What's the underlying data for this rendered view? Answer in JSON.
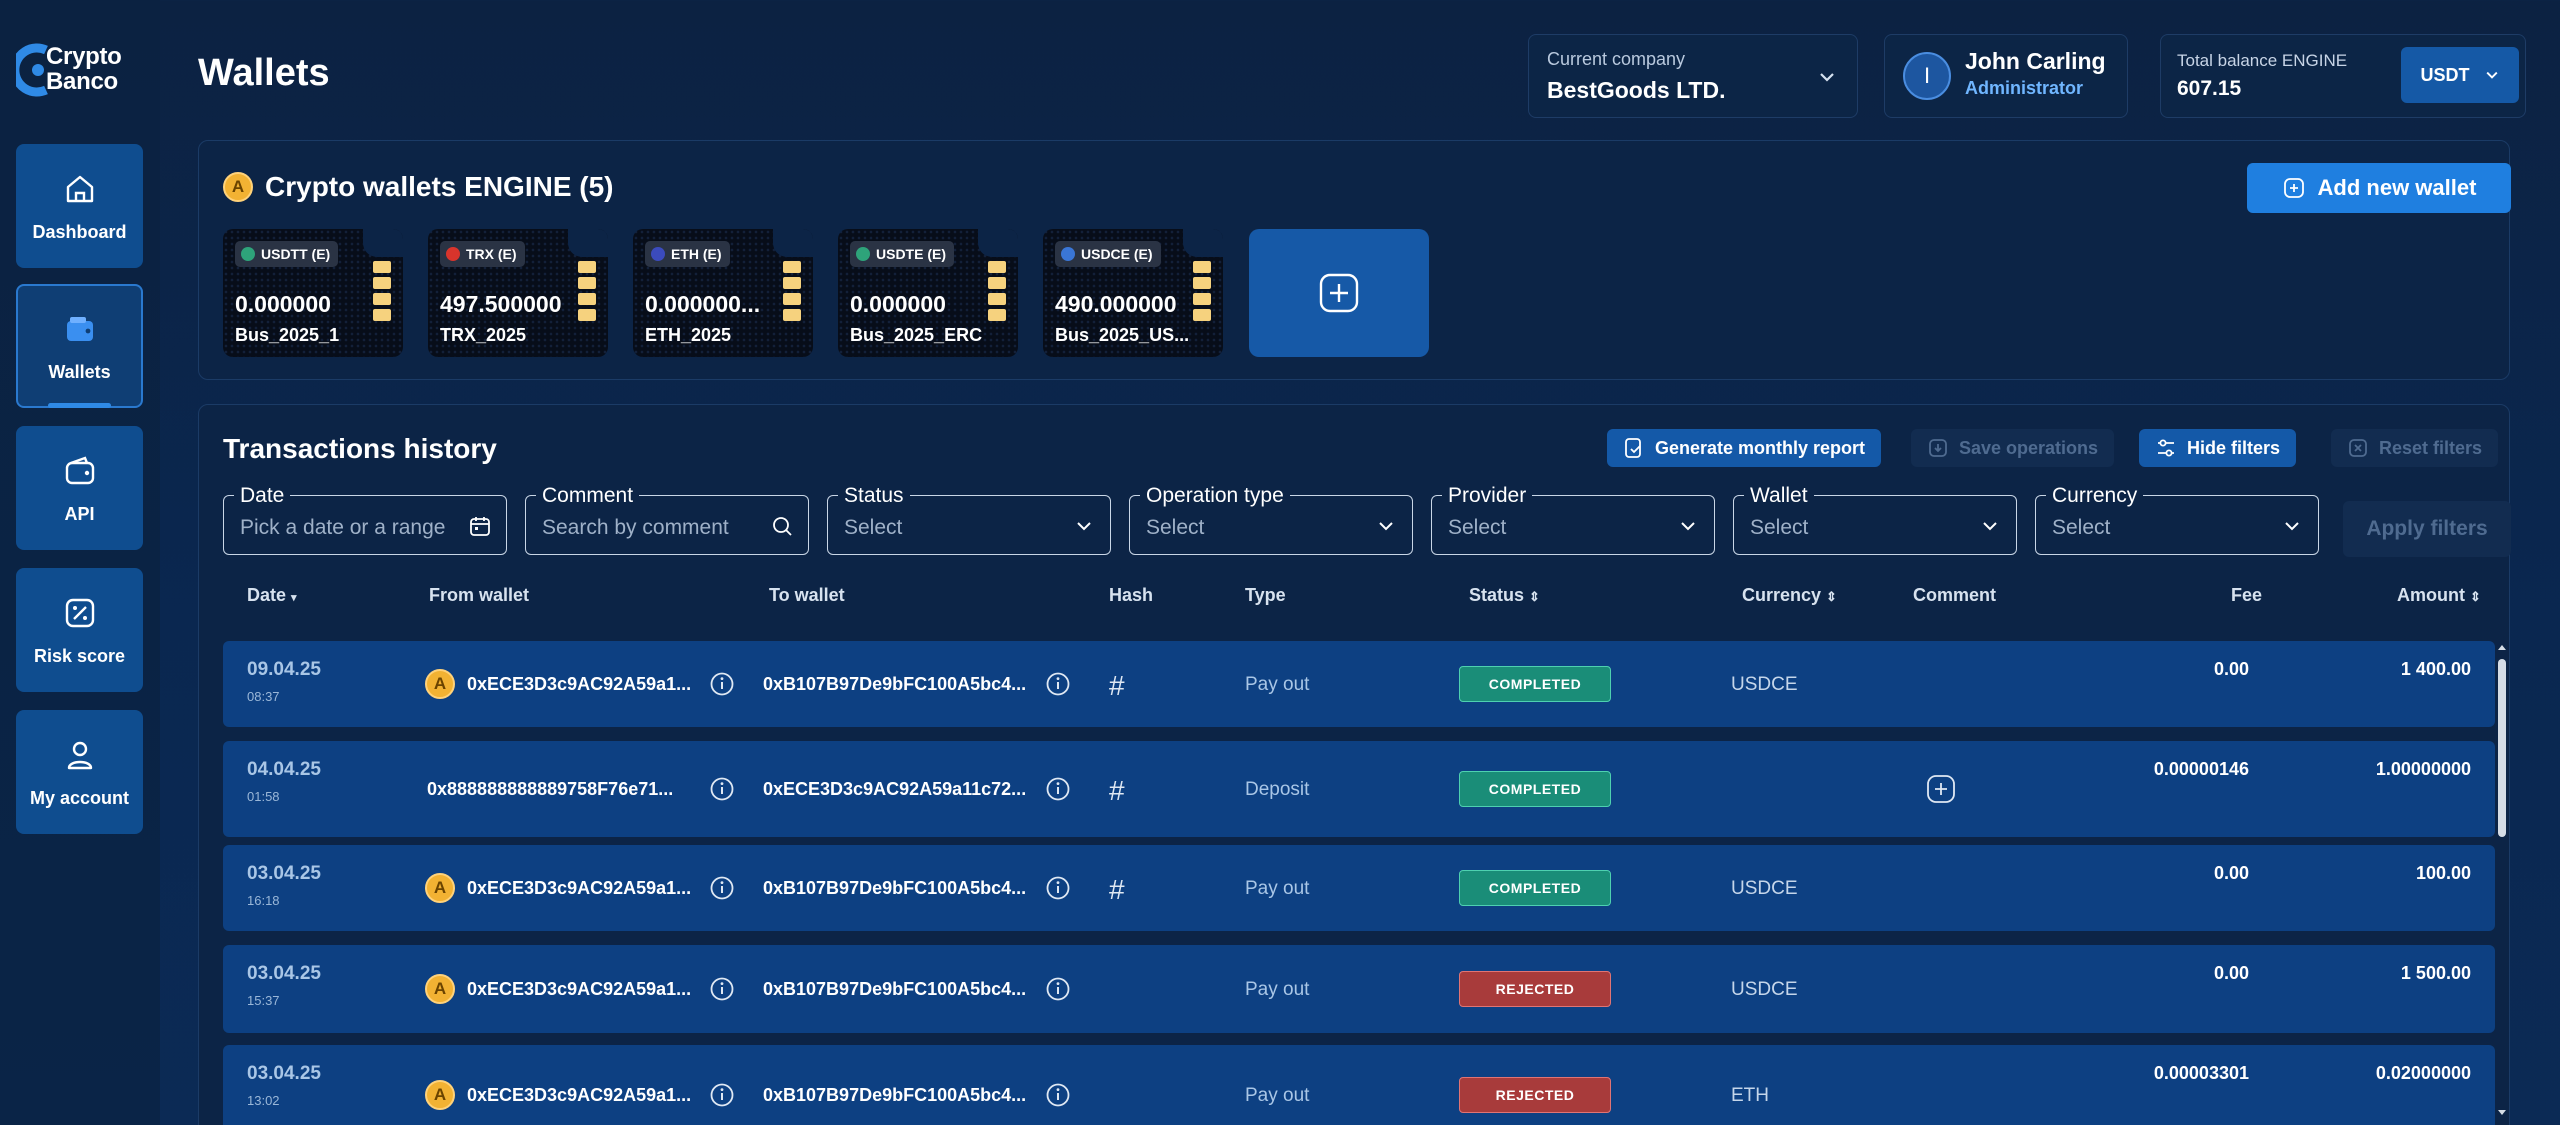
{
  "logo": {
    "line1": "Crypto",
    "line2": "Banco"
  },
  "sidebar": {
    "items": [
      {
        "label": "Dashboard",
        "icon": "home-icon"
      },
      {
        "label": "Wallets",
        "icon": "wallet-icon",
        "active": true
      },
      {
        "label": "API",
        "icon": "api-wallet-icon"
      },
      {
        "label": "Risk score",
        "icon": "percent-icon"
      },
      {
        "label": "My account",
        "icon": "user-icon"
      }
    ]
  },
  "header": {
    "title": "Wallets",
    "company": {
      "label": "Current company",
      "value": "BestGoods LTD."
    },
    "user": {
      "initial": "I",
      "name": "John Carling",
      "role": "Administrator"
    },
    "balance": {
      "label": "Total balance ENGINE",
      "value": "607.15",
      "currency": "USDT"
    }
  },
  "wallets_panel": {
    "title": "Crypto wallets ENGINE (5)",
    "coin_letter": "A",
    "add_button": "Add new wallet",
    "cards": [
      {
        "ticker": "USDTT (E)",
        "amount": "0.000000",
        "name": "Bus_2025_1",
        "dot": "#2ea37a"
      },
      {
        "ticker": "TRX (E)",
        "amount": "497.500000",
        "name": "TRX_2025",
        "dot": "#d8342c"
      },
      {
        "ticker": "ETH (E)",
        "amount": "0.000000...",
        "name": "ETH_2025",
        "dot": "#3b4bbd"
      },
      {
        "ticker": "USDTE (E)",
        "amount": "0.000000",
        "name": "Bus_2025_ERC",
        "dot": "#2ea37a"
      },
      {
        "ticker": "USDCE (E)",
        "amount": "490.000000",
        "name": "Bus_2025_US...",
        "dot": "#3a76d6"
      }
    ]
  },
  "transactions": {
    "title": "Transactions history",
    "buttons": {
      "report": "Generate monthly report",
      "save": "Save operations",
      "hide": "Hide filters",
      "reset": "Reset filters",
      "apply": "Apply filters"
    },
    "filters": [
      {
        "label": "Date",
        "placeholder": "Pick a date or a range"
      },
      {
        "label": "Comment",
        "placeholder": "Search by comment"
      },
      {
        "label": "Status",
        "placeholder": "Select"
      },
      {
        "label": "Operation type",
        "placeholder": "Select"
      },
      {
        "label": "Provider",
        "placeholder": "Select"
      },
      {
        "label": "Wallet",
        "placeholder": "Select"
      },
      {
        "label": "Currency",
        "placeholder": "Select"
      }
    ],
    "columns": {
      "date": "Date",
      "from": "From wallet",
      "to": "To wallet",
      "hash": "Hash",
      "type": "Type",
      "status": "Status",
      "currency": "Currency",
      "comment": "Comment",
      "fee": "Fee",
      "amount": "Amount"
    },
    "rows": [
      {
        "date": "09.04.25",
        "time": "08:37",
        "coin": true,
        "from": "0xECE3D3c9AC92A59a1...",
        "to": "0xB107B97De9bFC100A5bc4...",
        "hash": true,
        "type": "Pay out",
        "status": "COMPLETED",
        "status_kind": "ok",
        "currency": "USDCE",
        "comment_add": false,
        "fee": "0.00",
        "amount": "1 400.00"
      },
      {
        "date": "04.04.25",
        "time": "01:58",
        "coin": false,
        "from": "0x888888888889758F76e71...",
        "to": "0xECE3D3c9AC92A59a11c72...",
        "hash": true,
        "type": "Deposit",
        "status": "COMPLETED",
        "status_kind": "ok",
        "currency": "",
        "comment_add": true,
        "fee": "0.00000146",
        "amount": "1.00000000"
      },
      {
        "date": "03.04.25",
        "time": "16:18",
        "coin": true,
        "from": "0xECE3D3c9AC92A59a1...",
        "to": "0xB107B97De9bFC100A5bc4...",
        "hash": true,
        "type": "Pay out",
        "status": "COMPLETED",
        "status_kind": "ok",
        "currency": "USDCE",
        "comment_add": false,
        "fee": "0.00",
        "amount": "100.00"
      },
      {
        "date": "03.04.25",
        "time": "15:37",
        "coin": true,
        "from": "0xECE3D3c9AC92A59a1...",
        "to": "0xB107B97De9bFC100A5bc4...",
        "hash": false,
        "type": "Pay out",
        "status": "REJECTED",
        "status_kind": "bad",
        "currency": "USDCE",
        "comment_add": false,
        "fee": "0.00",
        "amount": "1 500.00"
      },
      {
        "date": "03.04.25",
        "time": "13:02",
        "coin": true,
        "from": "0xECE3D3c9AC92A59a1...",
        "to": "0xB107B97De9bFC100A5bc4...",
        "hash": false,
        "type": "Pay out",
        "status": "REJECTED",
        "status_kind": "bad",
        "currency": "ETH",
        "comment_add": false,
        "fee": "0.00003301",
        "amount": "0.02000000"
      }
    ]
  }
}
